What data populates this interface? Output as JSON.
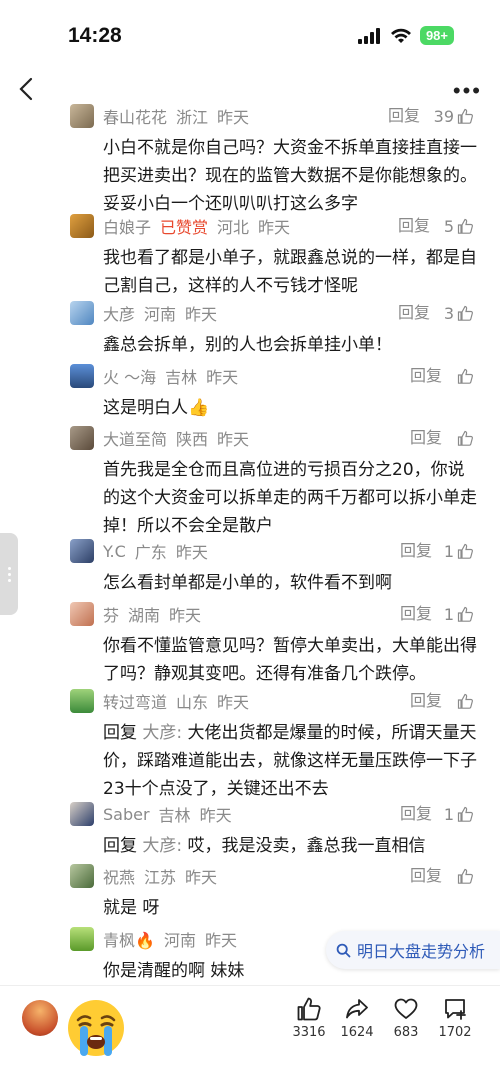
{
  "status": {
    "time": "14:28",
    "battery": "98+"
  },
  "float_search": {
    "label": "明日大盘走势分析"
  },
  "reply_label": "回复",
  "comments": [
    {
      "name": "春山花花",
      "location": "浙江",
      "time": "昨天",
      "likes": "39",
      "text": "小白不就是你自己吗？大资金不拆单直接挂直接一把买进卖出？现在的监管大数据不是你能想象的。妥妥小白一个还叭叭叭打这么多字"
    },
    {
      "name": "白娘子",
      "admire": "已赞赏",
      "location": "河北",
      "time": "昨天",
      "likes": "5",
      "text": "我也看了都是小单子，就跟鑫总说的一样，都是自己割自己，这样的人不亏钱才怪呢"
    },
    {
      "name": "大彦",
      "location": "河南",
      "time": "昨天",
      "likes": "3",
      "text": "鑫总会拆单，别的人也会拆单挂小单！"
    },
    {
      "name": "火 ～海",
      "location": "吉林",
      "time": "昨天",
      "likes": "",
      "text": "这是明白人👍"
    },
    {
      "name": "大道至简",
      "location": "陕西",
      "time": "昨天",
      "likes": "",
      "text": "首先我是全仓而且高位进的亏损百分之20，你说的这个大资金可以拆单走的两千万都可以拆小单走掉！所以不会全是散户"
    },
    {
      "name": "Y.C",
      "location": "广东",
      "time": "昨天",
      "likes": "1",
      "text": "怎么看封单都是小单的，软件看不到啊"
    },
    {
      "name": "芬",
      "location": "湖南",
      "time": "昨天",
      "likes": "1",
      "text": "你看不懂监管意见吗？暂停大单卖出，大单能出得了吗？静观其变吧。还得有准备几个跌停。"
    },
    {
      "name": "转过弯道",
      "location": "山东",
      "time": "昨天",
      "likes": "",
      "reply_prefix": "回复",
      "reply_to": "大彦:",
      "text": "大佬出货都是爆量的时候，所谓天量天价，踩踏难道能出去，就像这样无量压跌停一下子23十个点没了，关键还出不去"
    },
    {
      "name": "Saber",
      "location": "吉林",
      "time": "昨天",
      "likes": "1",
      "reply_prefix": "回复",
      "reply_to": "大彦:",
      "text": "哎，我是没卖，鑫总我一直相信"
    },
    {
      "name": "祝燕",
      "location": "江苏",
      "time": "昨天",
      "likes": "",
      "text": "就是 呀"
    },
    {
      "name": "青枫🔥",
      "location": "河南",
      "time": "昨天",
      "likes": "",
      "text": "你是清醒的啊 妹妹"
    }
  ],
  "actions": {
    "like": "3316",
    "share": "1624",
    "favorite": "683",
    "comment": "1702"
  },
  "colors": {
    "accent_red": "#e8492f",
    "link_blue": "#2f5bb8",
    "meta_gray": "#8a8a8a"
  }
}
